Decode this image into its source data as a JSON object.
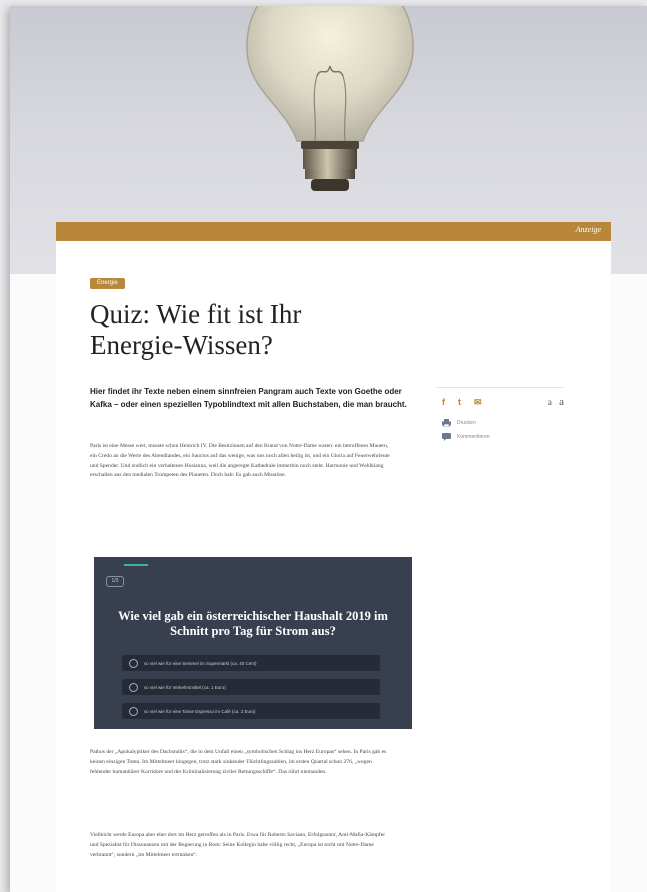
{
  "ad": {
    "label": "Anzeige"
  },
  "article": {
    "category": "Energie",
    "title": "Quiz: Wie fit ist Ihr Energie-Wissen?",
    "lead": "Hier findet ihr Texte neben einem sinnfreien Pangram auch Texte von Goethe oder Kafka – oder einen speziellen Typoblindtext mit allen Buchstaben, die man braucht.",
    "paragraph1": "Paris ist eine Messe wert, musste schon Heinrich IV. Die Besitzinnen auf den Brand von Notre-Dame waren: ein betroffenes Mauern, ein Credo an die Werte des Abendlandes, ein Sanctus auf das wenige, was uns noch allen heilig ist, und ein Gloria auf Feuerwehrleute und Spender. Und endlich ein verhaltenes Hosianna, weil die angeregte Kathedrale immerhin noch steht. Harmonie und Wohlklang erschallen aus den medialen Trompeten des Planeten. Doch halt: Es gab auch Misstöne.",
    "paragraph2": "Pathos der „Apokalyptiker des Dachstuhls“, die in dem Unfall einen „symbolischen Schlag ins Herz Europas“ sehen. In Paris gab es keinen einzigen Toten. Im Mittelmeer hingegen, trotz stark sinkender Flüchtlingszahlen, im ersten Quartal schon 276, „wegen fehlender humanitärer Korridore und der Kriminalisierung ziviler Rettungsschiffe“. Das rührt niemanden.",
    "paragraph3": "Vielleicht werde Europa aber eher dort im Herz getroffen als in Paris. Etwa für Roberto Saviano, Erfolgsautor, Anti-Mafia-Kämpfer und Spezialist für Dissonanzen mit der Regierung in Rom: Seine Kollegin habe völlig recht, „Europa ist nicht mit Notre-Dame verbrannt“, sondern „im Mittelmeer ertrunken“."
  },
  "sidebar": {
    "share": {
      "facebook": "f",
      "twitter": "t",
      "mail": "✉"
    },
    "font_small": "a",
    "font_large": "a",
    "print_label": "Drucken",
    "comment_label": "Kommentieren"
  },
  "quiz": {
    "progress": "1/3",
    "question": "Wie viel gab ein österreichischer Haushalt 2019 im Schnitt pro Tag für Strom aus?",
    "options": [
      "so viel wie für eine Semmel im Supermarkt (ca. 40 Cent)",
      "so viel wie für Verkehrsmittel (ca. 1 Euro)",
      "so viel wie für eine Tasse Espresso im Café (ca. 2 Euro)"
    ]
  },
  "colors": {
    "accent": "#b8873a",
    "quiz_bg": "#384050",
    "quiz_option_bg": "#262c37",
    "teal": "#3bb3a0"
  }
}
